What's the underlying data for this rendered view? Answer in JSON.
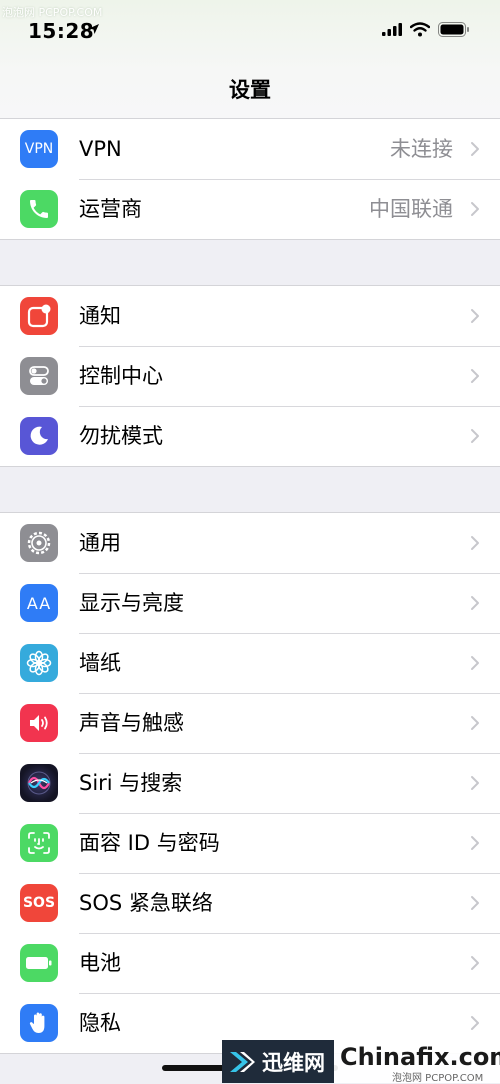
{
  "status": {
    "time": "15:28",
    "watermark_top": "泡泡网 PCPOP.COM"
  },
  "nav": {
    "title": "设置"
  },
  "groups": [
    {
      "items": [
        {
          "label": "VPN",
          "value": "未连接",
          "icon_text": "VPN",
          "icon": "vpn-icon",
          "color": "#2f7cf6"
        },
        {
          "label": "运营商",
          "value": "中国联通",
          "icon": "phone-icon",
          "color": "#4cd964"
        }
      ]
    },
    {
      "items": [
        {
          "label": "通知",
          "icon": "notifications-icon",
          "color": "#f0463a"
        },
        {
          "label": "控制中心",
          "icon": "control-center-icon",
          "color": "#8e8e93"
        },
        {
          "label": "勿扰模式",
          "icon": "moon-icon",
          "color": "#5856d6"
        }
      ]
    },
    {
      "items": [
        {
          "label": "通用",
          "icon": "gear-icon",
          "color": "#8e8e93"
        },
        {
          "label": "显示与亮度",
          "icon_text": "AA",
          "icon": "display-icon",
          "color": "#2f7cf6"
        },
        {
          "label": "墙纸",
          "icon": "wallpaper-icon",
          "color": "#35aadc"
        },
        {
          "label": "声音与触感",
          "icon": "sound-icon",
          "color": "#f2344f"
        },
        {
          "label": "Siri 与搜索",
          "icon": "siri-icon",
          "color": "#1b1b2e"
        },
        {
          "label": "面容 ID 与密码",
          "icon": "face-id-icon",
          "color": "#4cd964"
        },
        {
          "label": "SOS 紧急联络",
          "icon_text": "SOS",
          "icon": "sos-icon",
          "color": "#f0463a"
        },
        {
          "label": "电池",
          "icon": "battery-icon",
          "color": "#4cd964"
        },
        {
          "label": "隐私",
          "icon": "hand-icon",
          "color": "#2f7cf6"
        }
      ]
    }
  ],
  "watermark": {
    "left": "迅维网",
    "right": "Chinafix.com",
    "small": "泡泡网 PCPOP.COM"
  }
}
